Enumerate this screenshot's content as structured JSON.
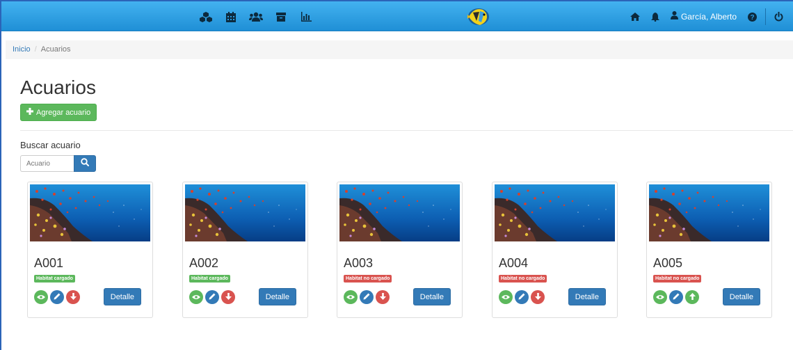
{
  "colors": {
    "navbar": "#2a9be0",
    "success": "#5cb85c",
    "primary": "#337ab7",
    "danger": "#d9534f"
  },
  "navbar": {
    "left_icons": [
      "cubes-icon",
      "calendar-icon",
      "users-icon",
      "archive-icon",
      "bar-chart-icon"
    ],
    "logo": "fish-logo",
    "right": {
      "home_icon": "home-icon",
      "bell_icon": "bell-icon",
      "user_icon": "user-icon",
      "user_name": "García, Alberto",
      "help_icon": "question-circle-icon",
      "power_icon": "power-icon"
    }
  },
  "breadcrumb": {
    "home": "Inicio",
    "separator": "/",
    "current": "Acuarios"
  },
  "page": {
    "title": "Acuarios",
    "add_button": "Agregar acuario"
  },
  "search": {
    "label": "Buscar acuario",
    "placeholder": "Acuario"
  },
  "cards": [
    {
      "title": "A001",
      "status": "Habitat cargado",
      "status_type": "ok",
      "third_action": "arrow-down-icon",
      "detail": "Detalle"
    },
    {
      "title": "A002",
      "status": "Habitat cargado",
      "status_type": "ok",
      "third_action": "arrow-down-icon",
      "detail": "Detalle"
    },
    {
      "title": "A003",
      "status": "Habitat no cargado",
      "status_type": "bad",
      "third_action": "arrow-down-icon",
      "detail": "Detalle"
    },
    {
      "title": "A004",
      "status": "Habitat no cargado",
      "status_type": "bad",
      "third_action": "arrow-down-icon",
      "detail": "Detalle"
    },
    {
      "title": "A005",
      "status": "Habitat no cargado",
      "status_type": "bad",
      "third_action": "arrow-up-icon",
      "detail": "Detalle"
    }
  ]
}
